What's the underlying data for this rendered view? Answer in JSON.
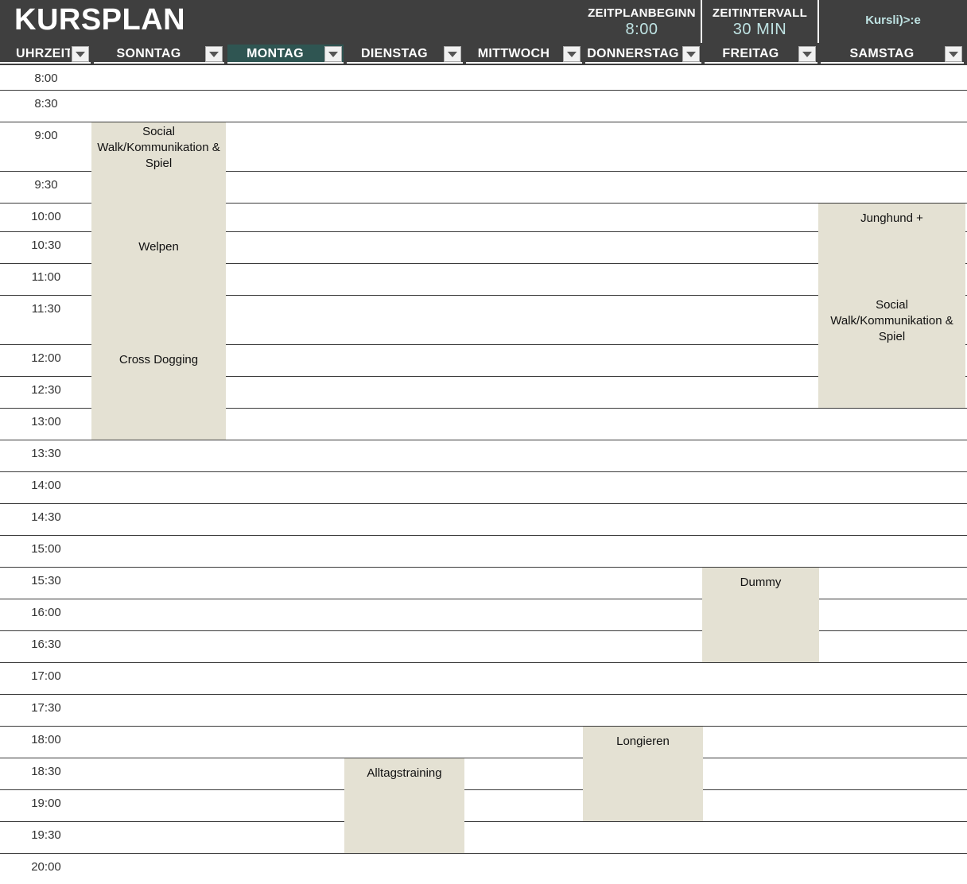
{
  "header": {
    "title": "KURSPLAN",
    "start_label": "ZEITPLANBEGINN",
    "start_value": "8:00",
    "interval_label": "ZEITINTERVALL",
    "interval_value": "30 MIN",
    "logo_text": "Kursli)>:e"
  },
  "columns": [
    "UHRZEIT",
    "SONNTAG",
    "MONTAG",
    "DIENSTAG",
    "MITTWOCH",
    "DONNERSTAG",
    "FREITAG",
    "SAMSTAG"
  ],
  "active_column": "MONTAG",
  "times": [
    "8:00",
    "8:30",
    "9:00",
    "9:30",
    "10:00",
    "10:30",
    "11:00",
    "11:30",
    "12:00",
    "12:30",
    "13:00",
    "13:30",
    "14:00",
    "14:30",
    "15:00",
    "15:30",
    "16:00",
    "16:30",
    "17:00",
    "17:30",
    "18:00",
    "18:30",
    "19:00",
    "19:30",
    "20:00"
  ],
  "events": [
    {
      "day": "SONNTAG",
      "start": "9:00",
      "end": "13:00",
      "labels": [
        {
          "text": "Social Walk/Kommunikation & Spiel",
          "time": "9:00"
        },
        {
          "text": "Welpen",
          "time": "10:30"
        },
        {
          "text": "Cross Dogging",
          "time": "12:00"
        }
      ]
    },
    {
      "day": "SAMSTAG",
      "start": "10:00",
      "end": "12:30",
      "labels": [
        {
          "text": "Junghund +",
          "time": "10:00"
        },
        {
          "text": "Social Walk/Kommunikation & Spiel",
          "time": "11:30"
        }
      ]
    },
    {
      "day": "FREITAG",
      "start": "15:30",
      "end": "16:30",
      "labels": [
        {
          "text": "Dummy",
          "time": "15:30"
        }
      ]
    },
    {
      "day": "DONNERSTAG",
      "start": "18:00",
      "end": "19:00",
      "labels": [
        {
          "text": "Longieren",
          "time": "18:00"
        }
      ]
    },
    {
      "day": "DIENSTAG",
      "start": "18:30",
      "end": "19:30",
      "labels": [
        {
          "text": "Alltagstraining",
          "time": "18:30"
        }
      ]
    }
  ]
}
